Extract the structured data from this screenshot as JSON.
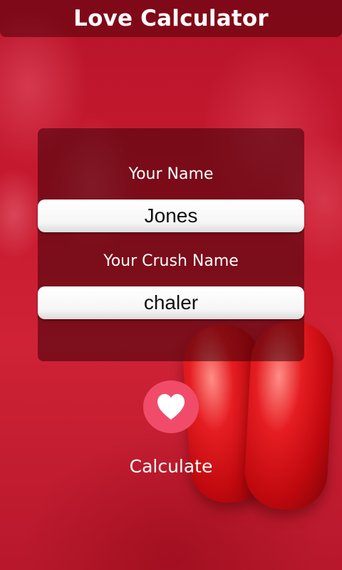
{
  "app": {
    "title": "Love Calculator"
  },
  "form": {
    "your_name_label": "Your Name",
    "your_name_value": "Jones",
    "crush_name_label": "Your Crush Name",
    "crush_name_value": "chaler"
  },
  "action": {
    "icon": "heart-icon",
    "label": "Calculate"
  },
  "colors": {
    "background": "#c81a30",
    "button": "#f04c69",
    "panel": "rgba(60,0,8,0.55)"
  }
}
